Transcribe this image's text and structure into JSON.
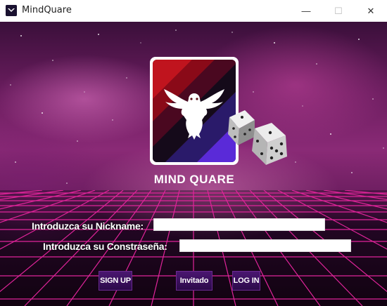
{
  "window": {
    "title": "MindQuare",
    "controls": {
      "minimize": "—",
      "maximize": "☐",
      "close": "✕"
    }
  },
  "logo": {
    "text": "MIND QUARE",
    "icon": "owl-logo",
    "decoration": "dice"
  },
  "form": {
    "nickname_label": "Introduzca su Nickname:",
    "nickname_value": "",
    "password_label": "Introduzca su Constraseña:",
    "password_value": ""
  },
  "buttons": {
    "signup": "SIGN UP",
    "guest": "Invitado",
    "login": "LOG IN"
  },
  "colors": {
    "button_bg": "#3a1060",
    "grid_line": "#e0249a",
    "sky": "#8a2a76"
  }
}
